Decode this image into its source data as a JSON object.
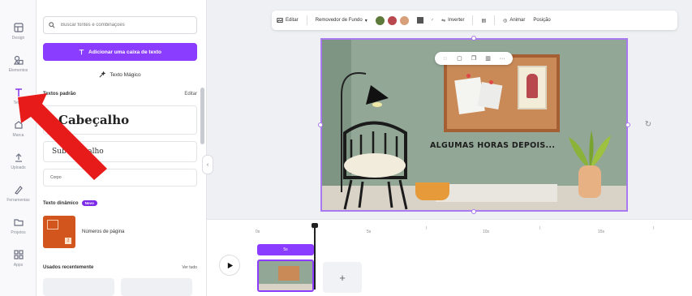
{
  "rail": {
    "items": [
      {
        "label": "Design",
        "icon": "layout-icon"
      },
      {
        "label": "Elementos",
        "icon": "shapes-icon"
      },
      {
        "label": "Texto",
        "icon": "text-icon"
      },
      {
        "label": "Marca",
        "icon": "brand-icon"
      },
      {
        "label": "Uploads",
        "icon": "upload-icon"
      },
      {
        "label": "Ferramentas",
        "icon": "draw-icon"
      },
      {
        "label": "Projetos",
        "icon": "folder-icon"
      },
      {
        "label": "Apps",
        "icon": "apps-icon"
      }
    ],
    "active_index": 2
  },
  "panel": {
    "search_placeholder": "Buscar fontes e combinações",
    "add_button": "Adicionar uma caixa de texto",
    "magic_text": "Texto Mágico",
    "default_section": "Textos padrão",
    "edit": "Editar",
    "heading": "Cabeçalho",
    "subheading": "Subcabeçalho",
    "body": "Corpo",
    "dynamic_section": "Texto dinâmico",
    "new_badge": "Novo",
    "page_numbers": "Números de página",
    "recent_section": "Usados recentemente",
    "see_all": "Ver tudo",
    "page_number_sample": "2"
  },
  "toolbar": {
    "edit": "Editar",
    "bg_remover": "Removedor de Fundo",
    "invert": "Inverter",
    "animate": "Animar",
    "position": "Posição",
    "colors": [
      "#5d7a3b",
      "#b8484e",
      "#d7a07a"
    ]
  },
  "canvas": {
    "title": "ALGUMAS HORAS DEPOIS..."
  },
  "timeline": {
    "ticks": [
      "0s",
      "5s",
      "10s",
      "15s"
    ],
    "clip_label": "5s",
    "add_label": "+"
  }
}
